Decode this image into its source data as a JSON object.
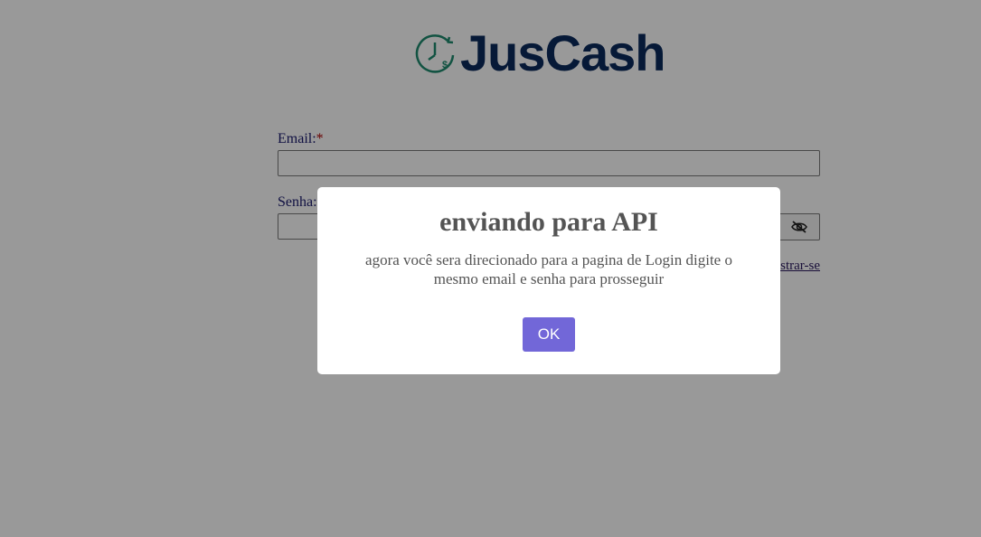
{
  "logo": {
    "text": "JusCash",
    "icon": "clock-dollar-icon",
    "icon_symbol": "$",
    "colors": {
      "text": "#0a2a5c",
      "icon": "#1e8a6e"
    }
  },
  "form": {
    "email_label": "Email:",
    "email_required_mark": "*",
    "email_value": "",
    "password_label": "Senha:",
    "password_value": "",
    "password_toggle_icon": "eye-slash-icon",
    "register_link": "Registrar-se"
  },
  "dialog": {
    "title": "enviando para API",
    "message": "agora você sera direcionado para a pagina de Login digite o mesmo email e senha para prosseguir",
    "ok_label": "OK",
    "colors": {
      "ok_button": "#7267d8",
      "text": "#545454"
    }
  }
}
